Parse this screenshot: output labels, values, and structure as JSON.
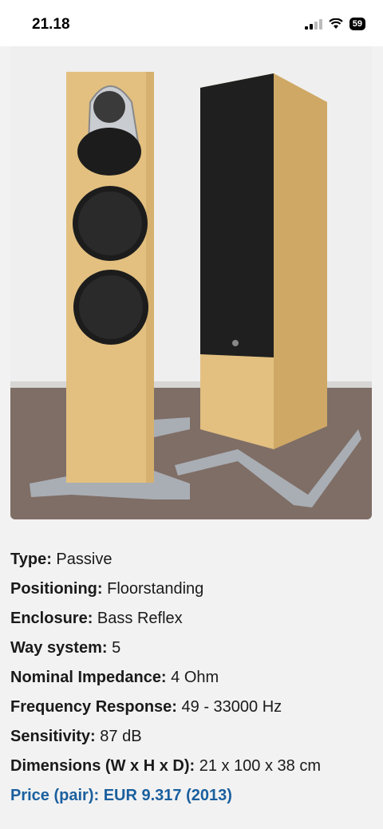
{
  "status_bar": {
    "time": "21.18",
    "battery": "59"
  },
  "product_image": {
    "icon": "speaker-pair-image",
    "colors": {
      "wood": "#e3c080",
      "grille": "#1f1f1f",
      "base": "#a9aeb4",
      "floor": "#7f6e66"
    }
  },
  "specs": [
    {
      "label": "Type:",
      "value": "Passive"
    },
    {
      "label": "Positioning:",
      "value": "Floorstanding"
    },
    {
      "label": "Enclosure:",
      "value": "Bass Reflex"
    },
    {
      "label": "Way system:",
      "value": "5"
    },
    {
      "label": "Nominal Impedance:",
      "value": "4 Ohm"
    },
    {
      "label": "Frequency Response:",
      "value": "49 - 33000 Hz"
    },
    {
      "label": "Sensitivity:",
      "value": "87 dB"
    },
    {
      "label": "Dimensions (W x H x D):",
      "value": "21 x 100 x 38 cm"
    }
  ],
  "price": {
    "label": "Price (pair):",
    "value": "EUR 9.317 (2013)",
    "color": "#1a5f9e"
  }
}
